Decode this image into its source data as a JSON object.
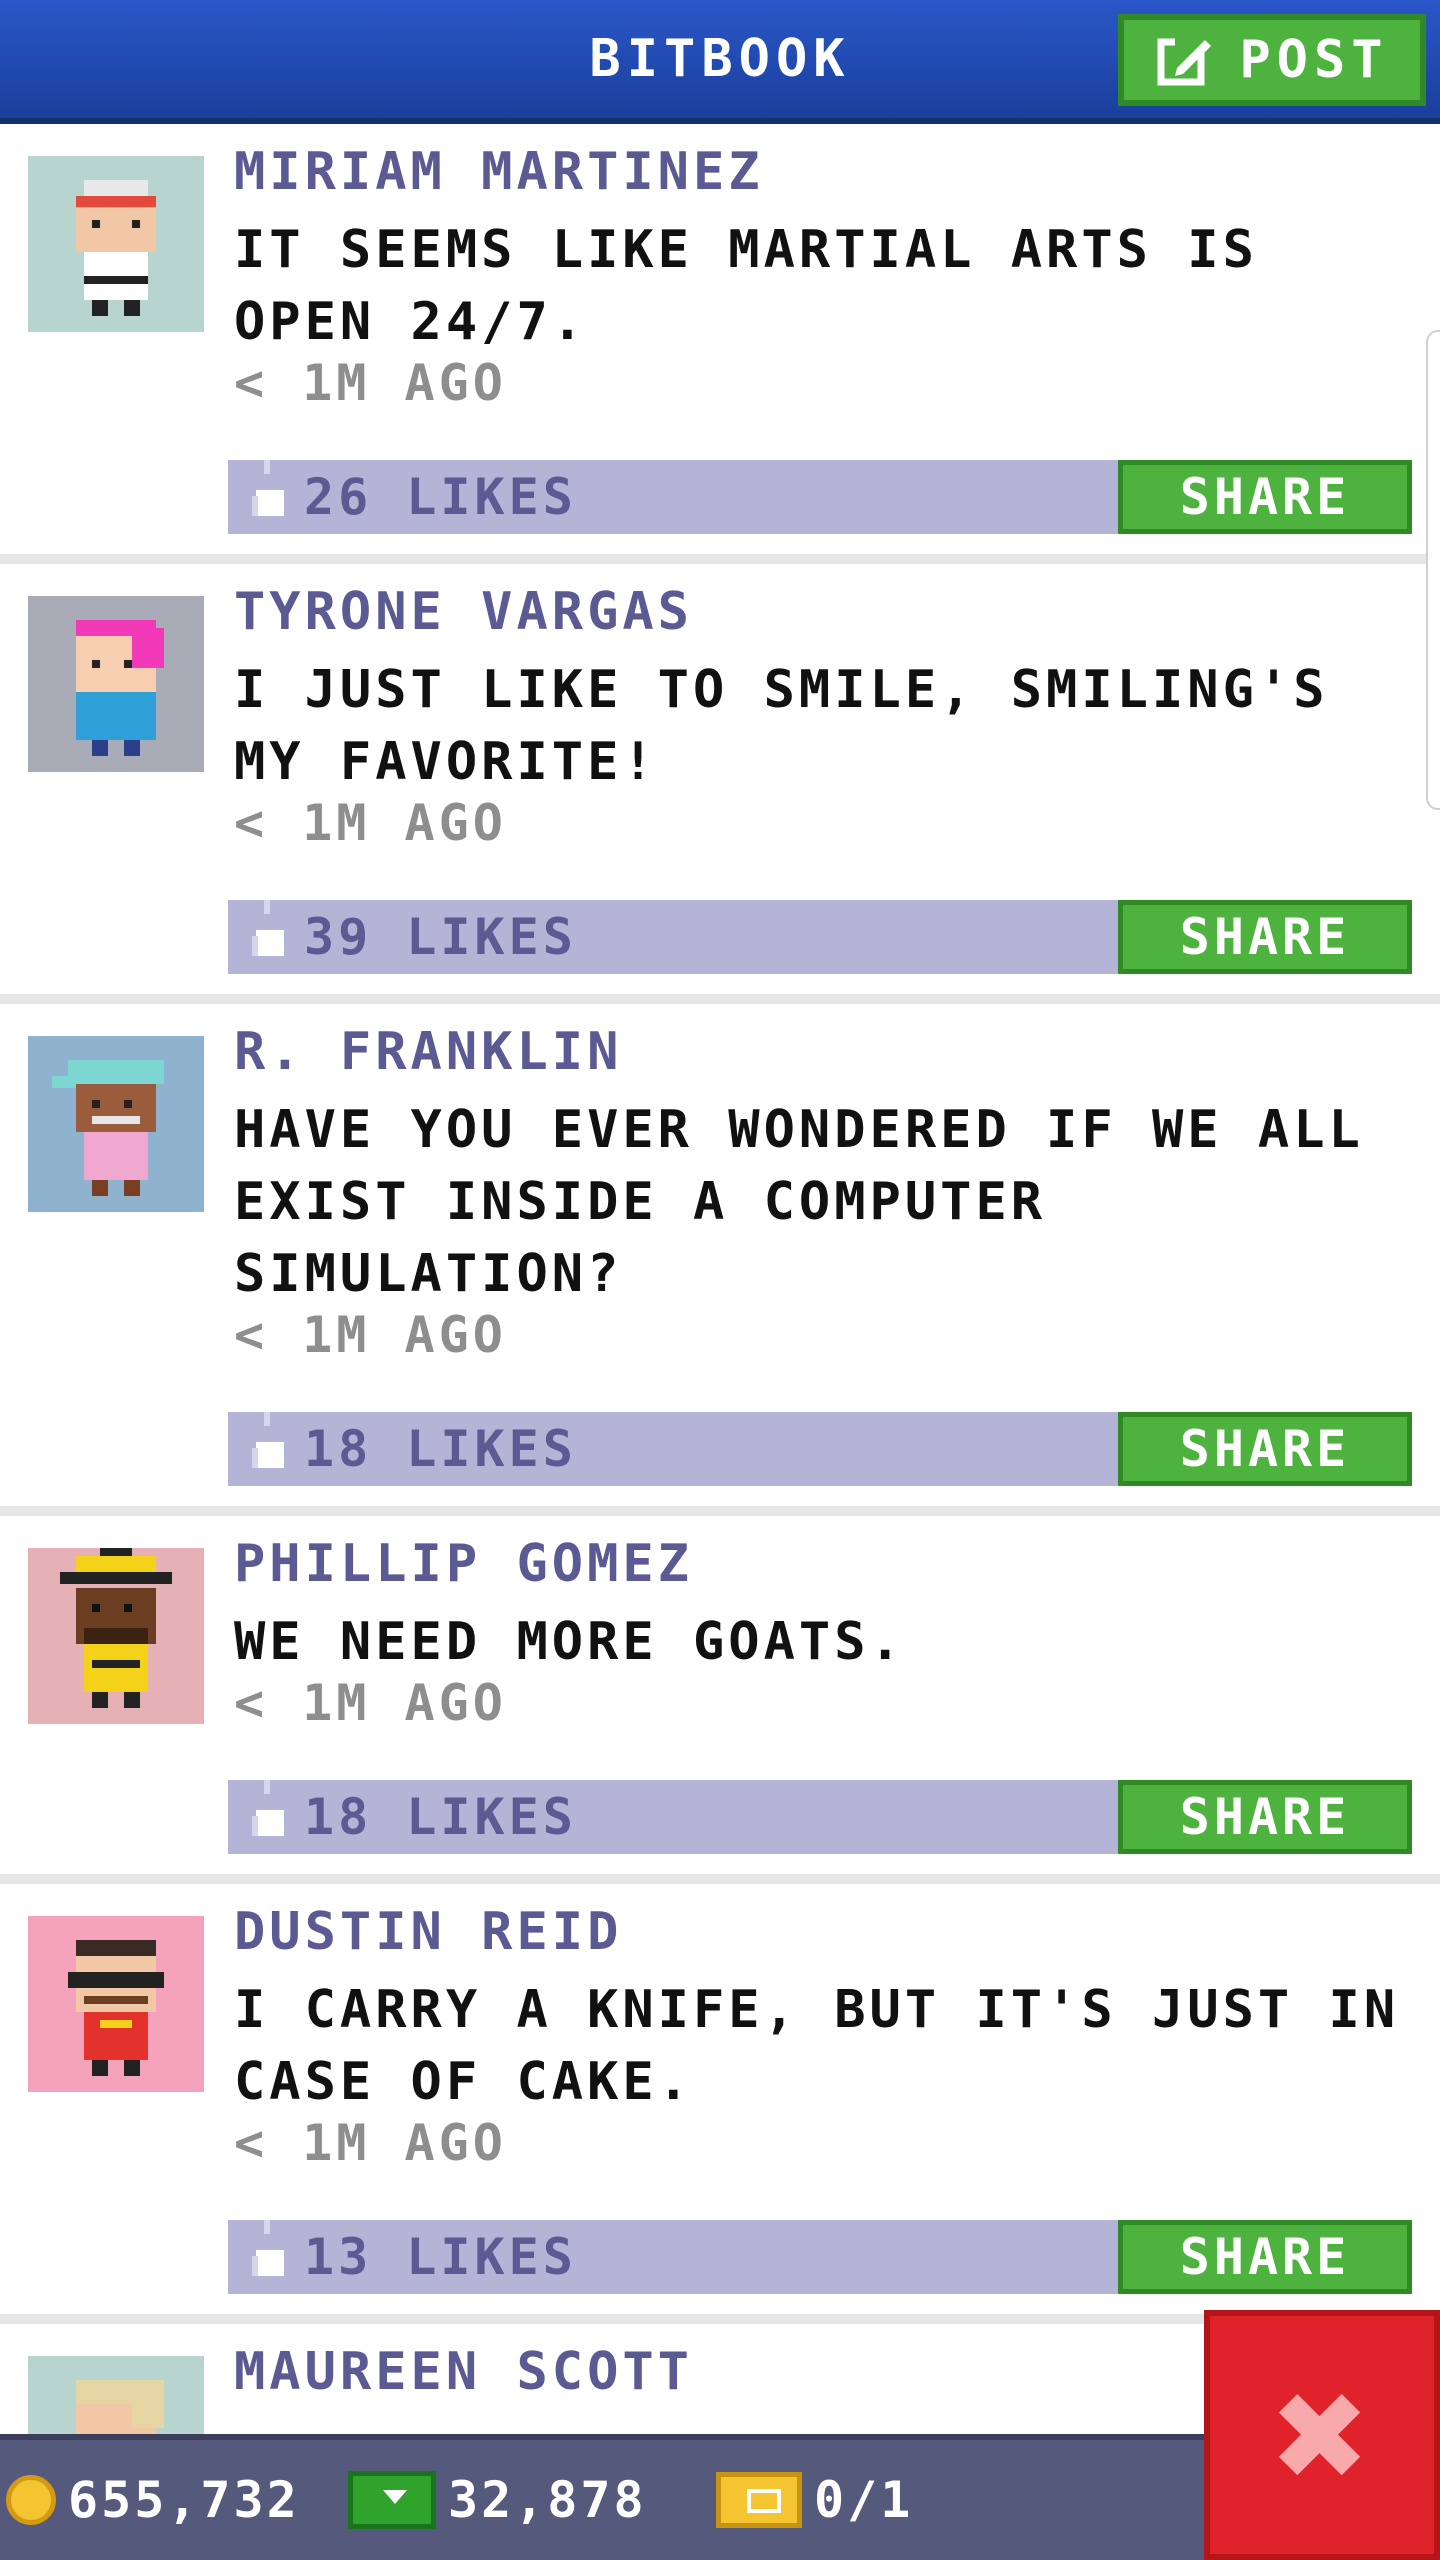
{
  "header": {
    "title": "BITBOOK",
    "post_label": "POST"
  },
  "posts": [
    {
      "name": "MIRIAM MARTINEZ",
      "text": "IT SEEMS LIKE MARTIAL ARTS IS OPEN 24/7.",
      "time": "< 1M AGO",
      "likes": "26 LIKES",
      "share_label": "SHARE",
      "avatar_bg": "#b7d4cf",
      "hair": "#e8e8e8",
      "shirt": "#ffffff",
      "band": "#e34a3a"
    },
    {
      "name": "TYRONE VARGAS",
      "text": "I JUST LIKE TO SMILE, SMILING'S MY FAVORITE!",
      "time": "< 1M AGO",
      "likes": "39 LIKES",
      "share_label": "SHARE",
      "avatar_bg": "#a9abb7",
      "hair": "#f23ab8",
      "shirt": "#2f9fd8",
      "band": ""
    },
    {
      "name": "R. FRANKLIN",
      "text": "HAVE YOU EVER WONDERED IF WE ALL EXIST INSIDE A COMPUTER SIMULATION?",
      "time": "< 1M AGO",
      "likes": "18 LIKES",
      "share_label": "SHARE",
      "avatar_bg": "#8fb2cf",
      "hair": "#7ed6d2",
      "shirt": "#f1a8d0",
      "band": ""
    },
    {
      "name": "PHILLIP GOMEZ",
      "text": "WE NEED MORE GOATS.",
      "time": "< 1M AGO",
      "likes": "18 LIKES",
      "share_label": "SHARE",
      "avatar_bg": "#e5b1b6",
      "hair": "#f4d21a",
      "shirt": "#f4d21a",
      "band": ""
    },
    {
      "name": "DUSTIN REID",
      "text": "I CARRY A KNIFE, BUT IT'S JUST IN CASE OF CAKE.",
      "time": "< 1M AGO",
      "likes": "13 LIKES",
      "share_label": "SHARE",
      "avatar_bg": "#f5a3bd",
      "hair": "#3a2a26",
      "shirt": "#e2322b",
      "band": ""
    },
    {
      "name": "MAUREEN SCOTT",
      "text": "",
      "time": "",
      "likes": "",
      "share_label": "",
      "avatar_bg": "#b7d4cf",
      "hair": "#e6d6a4",
      "shirt": "#ffffff",
      "band": ""
    }
  ],
  "bottom_bar": {
    "coins": "655,732",
    "bux": "32,878",
    "tickets": "0/1"
  },
  "icons": {
    "post": "edit-icon",
    "like": "thumbs-up-icon",
    "coin": "coin-icon",
    "bux": "bux-icon",
    "ticket": "ticket-icon",
    "close": "close-icon"
  },
  "colors": {
    "header": "#2a57c8",
    "accent_green": "#4eb33e",
    "likes_bar": "#b4b4d6",
    "name": "#5b5a92",
    "close": "#e0232a"
  }
}
